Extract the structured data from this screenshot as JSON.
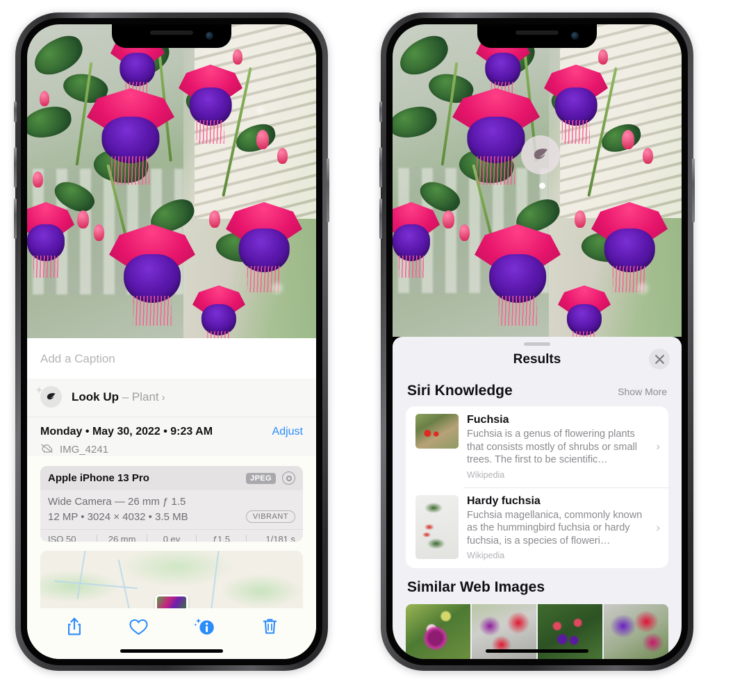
{
  "left_phone": {
    "photo": {
      "alt": "fuchsia-flowers-photo"
    },
    "caption_placeholder": "Add a Caption",
    "lookup": {
      "icon": "leaf-icon",
      "sparkle_icon": "sparkles-icon",
      "label": "Look Up",
      "dash": " – ",
      "subject": "Plant",
      "chevron": "›"
    },
    "date": "Monday • May 30, 2022 • 9:23 AM",
    "adjust_label": "Adjust",
    "cloud_icon": "cloud-slash-icon",
    "filename": "IMG_4241",
    "exif": {
      "device": "Apple iPhone 13 Pro",
      "format_badge": "JPEG",
      "lens_icon": "lens-icon",
      "camera_line": "Wide Camera — 26 mm ƒ 1.5",
      "specs_line": "12 MP • 3024 × 4032 • 3.5 MB",
      "style_badge": "VIBRANT",
      "stats": [
        "ISO 50",
        "26 mm",
        "0 ev",
        "ƒ1.5",
        "1/181 s"
      ]
    },
    "toolbar": {
      "share": "share-icon",
      "favorite": "heart-icon",
      "info": "info-sparkle-icon",
      "delete": "trash-icon"
    }
  },
  "right_phone": {
    "vlu_badge_icon": "leaf-icon",
    "drawer": {
      "title": "Results",
      "close_icon": "close-icon",
      "siri_section": {
        "title": "Siri Knowledge",
        "show_more": "Show More",
        "items": [
          {
            "title": "Fuchsia",
            "description": "Fuchsia is a genus of flowering plants that consists mostly of shrubs or small trees. The first to be scientific…",
            "source": "Wikipedia",
            "chevron": "›",
            "thumb": "fuchsia-red-flowers-thumbnail"
          },
          {
            "title": "Hardy fuchsia",
            "description": "Fuchsia magellanica, commonly known as the hummingbird fuchsia or hardy fuchsia, is a species of floweri…",
            "source": "Wikipedia",
            "chevron": "›",
            "thumb": "hardy-fuchsia-branch-thumbnail"
          }
        ]
      },
      "web_section": {
        "title": "Similar Web Images",
        "images": [
          "fuchsia-web-image-1",
          "fuchsia-web-image-2",
          "fuchsia-web-image-3",
          "fuchsia-web-image-4"
        ]
      }
    }
  },
  "colors": {
    "accent_blue": "#2b8cfb",
    "drawer_bg": "#f1f1f5",
    "sheet_bg": "#fdfdf8",
    "card_bg": "#ffffff"
  }
}
